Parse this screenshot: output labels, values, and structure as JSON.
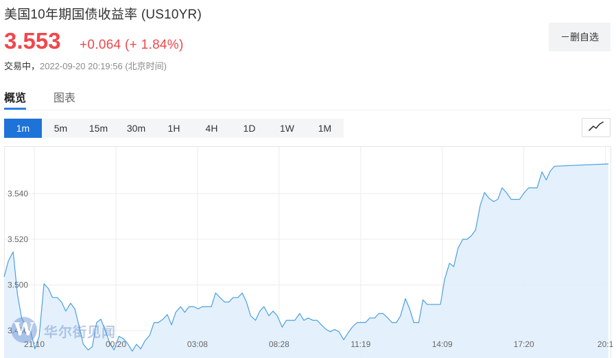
{
  "header": {
    "title": "美国10年期国债收益率 (US10YR)",
    "price": "3.553",
    "change": "+0.064 (+ 1.84%)",
    "status": "交易中，",
    "timestamp": "2022-09-20 20:19:56 (北京时间)",
    "remove_label": "－删自选"
  },
  "tabs": [
    {
      "label": "概览",
      "active": true
    },
    {
      "label": "图表",
      "active": false
    }
  ],
  "ranges": [
    {
      "label": "1m",
      "active": true
    },
    {
      "label": "5m",
      "active": false
    },
    {
      "label": "15m",
      "active": false
    },
    {
      "label": "30m",
      "active": false
    },
    {
      "label": "1H",
      "active": false
    },
    {
      "label": "4H",
      "active": false
    },
    {
      "label": "1D",
      "active": false
    },
    {
      "label": "1W",
      "active": false
    },
    {
      "label": "1M",
      "active": false
    }
  ],
  "chart_type_icon": "line-chart-icon",
  "watermark": {
    "logo_letter": "W",
    "text": "华尔街见闻"
  },
  "colors": {
    "up": "#f0474b",
    "accent": "#1e73d8",
    "line": "#4a9fe0",
    "area": "#e1effd"
  },
  "chart_data": {
    "type": "area",
    "title": "",
    "xlabel": "",
    "ylabel": "",
    "ylim": [
      3.468,
      3.5605
    ],
    "yticks": [
      {
        "value": 3.48,
        "label": "3.480"
      },
      {
        "value": 3.5,
        "label": "3.500"
      },
      {
        "value": 3.52,
        "label": "3.520"
      },
      {
        "value": 3.54,
        "label": "3.540"
      }
    ],
    "xrange": [
      0,
      1
    ],
    "xticks": [
      {
        "x": 0.05,
        "label": "21:10"
      },
      {
        "x": 0.185,
        "label": "00:20"
      },
      {
        "x": 0.32,
        "label": "03:08"
      },
      {
        "x": 0.455,
        "label": "08:28"
      },
      {
        "x": 0.59,
        "label": "11:19"
      },
      {
        "x": 0.725,
        "label": "14:09"
      },
      {
        "x": 0.86,
        "label": "17:20"
      },
      {
        "x": 0.995,
        "label": "20:1"
      }
    ],
    "points": [
      [
        0.0,
        3.5035
      ],
      [
        0.007,
        3.5105
      ],
      [
        0.015,
        3.5145
      ],
      [
        0.022,
        3.496
      ],
      [
        0.029,
        3.4855
      ],
      [
        0.036,
        3.482
      ],
      [
        0.044,
        3.4795
      ],
      [
        0.051,
        3.472
      ],
      [
        0.058,
        3.4775
      ],
      [
        0.066,
        3.5005
      ],
      [
        0.073,
        3.4985
      ],
      [
        0.08,
        3.4945
      ],
      [
        0.088,
        3.4945
      ],
      [
        0.095,
        3.4925
      ],
      [
        0.102,
        3.4885
      ],
      [
        0.11,
        3.492
      ],
      [
        0.117,
        3.4895
      ],
      [
        0.124,
        3.482
      ],
      [
        0.131,
        3.474
      ],
      [
        0.139,
        3.4715
      ],
      [
        0.146,
        3.473
      ],
      [
        0.153,
        3.4835
      ],
      [
        0.16,
        3.485
      ],
      [
        0.168,
        3.4795
      ],
      [
        0.175,
        3.4745
      ],
      [
        0.182,
        3.4715
      ],
      [
        0.19,
        3.4775
      ],
      [
        0.197,
        3.4765
      ],
      [
        0.204,
        3.4745
      ],
      [
        0.212,
        3.471
      ],
      [
        0.219,
        3.474
      ],
      [
        0.226,
        3.472
      ],
      [
        0.233,
        3.4755
      ],
      [
        0.241,
        3.478
      ],
      [
        0.248,
        3.4835
      ],
      [
        0.255,
        3.4835
      ],
      [
        0.263,
        3.485
      ],
      [
        0.27,
        3.487
      ],
      [
        0.277,
        3.4825
      ],
      [
        0.284,
        3.488
      ],
      [
        0.292,
        3.4905
      ],
      [
        0.299,
        3.488
      ],
      [
        0.306,
        3.4905
      ],
      [
        0.314,
        3.4905
      ],
      [
        0.321,
        3.4895
      ],
      [
        0.328,
        3.4905
      ],
      [
        0.336,
        3.4905
      ],
      [
        0.343,
        3.4905
      ],
      [
        0.35,
        3.4965
      ],
      [
        0.357,
        3.4945
      ],
      [
        0.365,
        3.4925
      ],
      [
        0.372,
        3.4925
      ],
      [
        0.379,
        3.4945
      ],
      [
        0.387,
        3.4945
      ],
      [
        0.394,
        3.4965
      ],
      [
        0.401,
        3.4925
      ],
      [
        0.408,
        3.4865
      ],
      [
        0.416,
        3.4845
      ],
      [
        0.423,
        3.4885
      ],
      [
        0.43,
        3.4905
      ],
      [
        0.438,
        3.4865
      ],
      [
        0.445,
        3.4885
      ],
      [
        0.452,
        3.4865
      ],
      [
        0.46,
        3.4815
      ],
      [
        0.467,
        3.4845
      ],
      [
        0.474,
        3.4845
      ],
      [
        0.481,
        3.4845
      ],
      [
        0.489,
        3.4875
      ],
      [
        0.496,
        3.4845
      ],
      [
        0.503,
        3.4855
      ],
      [
        0.511,
        3.4845
      ],
      [
        0.518,
        3.4845
      ],
      [
        0.525,
        3.4825
      ],
      [
        0.533,
        3.4805
      ],
      [
        0.54,
        3.4795
      ],
      [
        0.547,
        3.4805
      ],
      [
        0.554,
        3.4795
      ],
      [
        0.562,
        3.476
      ],
      [
        0.569,
        3.479
      ],
      [
        0.576,
        3.4815
      ],
      [
        0.584,
        3.4835
      ],
      [
        0.591,
        3.4835
      ],
      [
        0.598,
        3.4835
      ],
      [
        0.605,
        3.4855
      ],
      [
        0.613,
        3.4855
      ],
      [
        0.62,
        3.4875
      ],
      [
        0.627,
        3.4875
      ],
      [
        0.635,
        3.4855
      ],
      [
        0.642,
        3.4835
      ],
      [
        0.649,
        3.4835
      ],
      [
        0.656,
        3.4865
      ],
      [
        0.664,
        3.494
      ],
      [
        0.671,
        3.4895
      ],
      [
        0.678,
        3.4835
      ],
      [
        0.686,
        3.4835
      ],
      [
        0.693,
        3.4935
      ],
      [
        0.7,
        3.4915
      ],
      [
        0.707,
        3.4915
      ],
      [
        0.715,
        3.4915
      ],
      [
        0.722,
        3.4915
      ],
      [
        0.729,
        3.5025
      ],
      [
        0.737,
        3.5095
      ],
      [
        0.744,
        3.508
      ],
      [
        0.751,
        3.516
      ],
      [
        0.759,
        3.52
      ],
      [
        0.766,
        3.52
      ],
      [
        0.773,
        3.5215
      ],
      [
        0.78,
        3.524
      ],
      [
        0.788,
        3.535
      ],
      [
        0.795,
        3.5405
      ],
      [
        0.802,
        3.538
      ],
      [
        0.81,
        3.5365
      ],
      [
        0.817,
        3.5375
      ],
      [
        0.824,
        3.5425
      ],
      [
        0.831,
        3.5405
      ],
      [
        0.839,
        3.5375
      ],
      [
        0.846,
        3.5375
      ],
      [
        0.853,
        3.5375
      ],
      [
        0.861,
        3.5405
      ],
      [
        0.868,
        3.5425
      ],
      [
        0.875,
        3.5425
      ],
      [
        0.882,
        3.5425
      ],
      [
        0.89,
        3.5495
      ],
      [
        0.897,
        3.546
      ],
      [
        0.904,
        3.55
      ],
      [
        0.911,
        3.552
      ],
      [
        1.0,
        3.553
      ]
    ]
  }
}
